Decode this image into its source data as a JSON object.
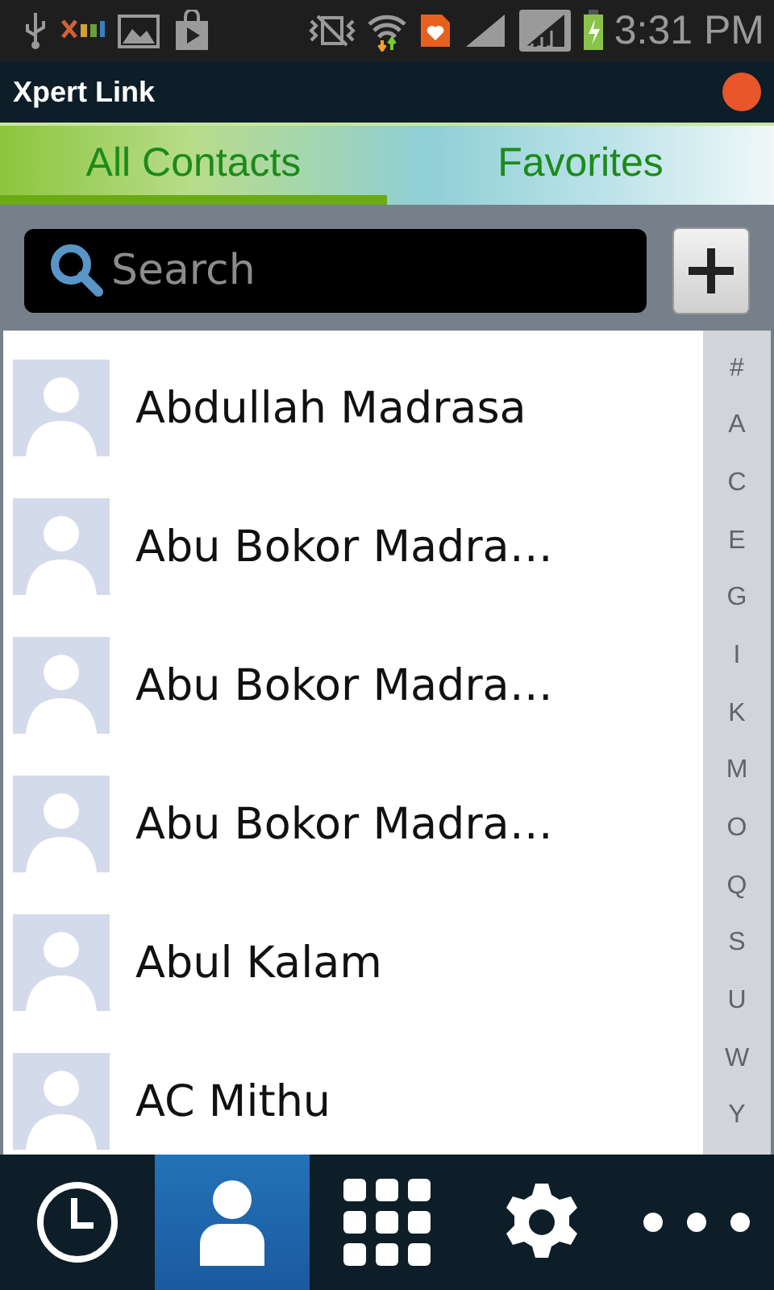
{
  "status_bar": {
    "time": "3:31 PM"
  },
  "app_bar": {
    "title": "Xpert Link"
  },
  "tabs": [
    {
      "label": "All Contacts",
      "selected": true
    },
    {
      "label": "Favorites",
      "selected": false
    }
  ],
  "search": {
    "placeholder": "Search"
  },
  "contacts": [
    {
      "name": "Abdullah Madrasa"
    },
    {
      "name": "Abu Bokor Madra…"
    },
    {
      "name": "Abu Bokor Madra…"
    },
    {
      "name": "Abu Bokor Madra…"
    },
    {
      "name": "Abul Kalam"
    },
    {
      "name": "AC Mithu"
    }
  ],
  "index_letters": [
    "#",
    "A",
    "C",
    "E",
    "G",
    "I",
    "K",
    "M",
    "O",
    "Q",
    "S",
    "U",
    "W",
    "Y"
  ],
  "nav": [
    {
      "kind": "history",
      "selected": false
    },
    {
      "kind": "contacts",
      "selected": true
    },
    {
      "kind": "dialpad",
      "selected": false
    },
    {
      "kind": "settings",
      "selected": false
    },
    {
      "kind": "more",
      "selected": false
    }
  ]
}
